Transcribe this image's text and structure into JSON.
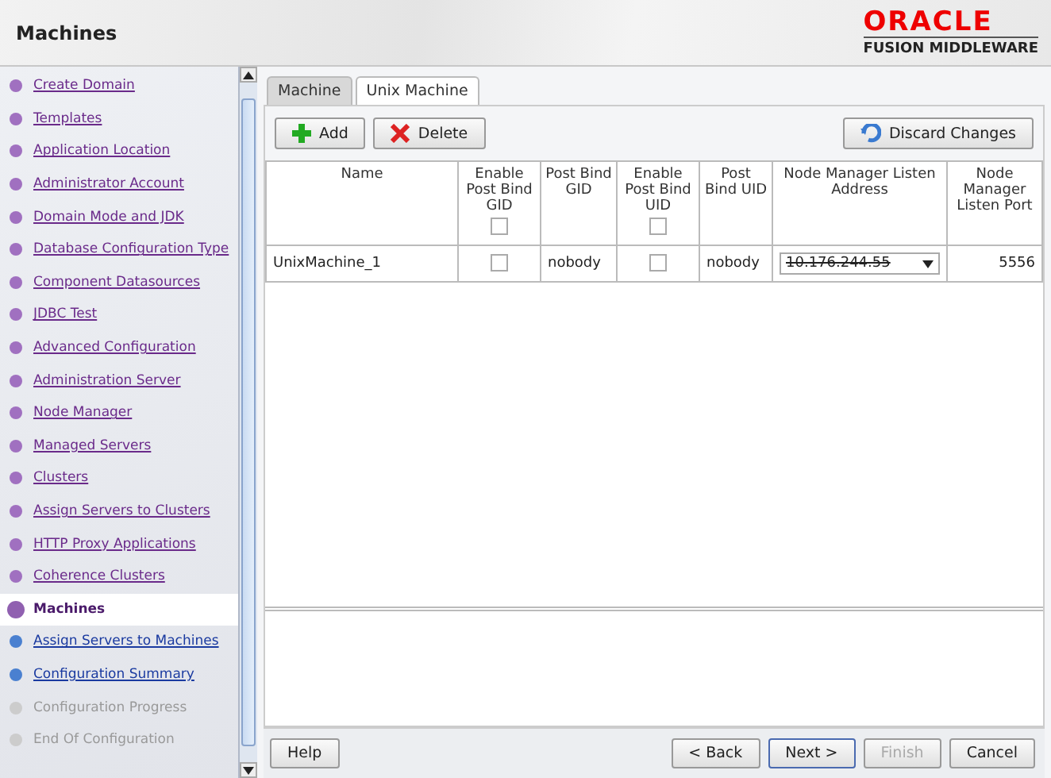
{
  "header": {
    "title": "Machines",
    "logo_top": "ORACLE",
    "logo_bottom": "FUSION MIDDLEWARE"
  },
  "steps": [
    {
      "label": "Create Domain",
      "kind": "visited"
    },
    {
      "label": "Templates",
      "kind": "visited"
    },
    {
      "label": "Application Location",
      "kind": "visited"
    },
    {
      "label": "Administrator Account",
      "kind": "visited"
    },
    {
      "label": "Domain Mode and JDK",
      "kind": "visited"
    },
    {
      "label": "Database Configuration Type",
      "kind": "visited"
    },
    {
      "label": "Component Datasources",
      "kind": "visited"
    },
    {
      "label": "JDBC Test",
      "kind": "visited"
    },
    {
      "label": "Advanced Configuration",
      "kind": "visited"
    },
    {
      "label": "Administration Server",
      "kind": "visited"
    },
    {
      "label": "Node Manager",
      "kind": "visited"
    },
    {
      "label": "Managed Servers",
      "kind": "visited"
    },
    {
      "label": "Clusters",
      "kind": "visited"
    },
    {
      "label": "Assign Servers to Clusters",
      "kind": "visited"
    },
    {
      "label": "HTTP Proxy Applications",
      "kind": "visited"
    },
    {
      "label": "Coherence Clusters",
      "kind": "visited"
    },
    {
      "label": "Machines",
      "kind": "current"
    },
    {
      "label": "Assign Servers to Machines",
      "kind": "pending"
    },
    {
      "label": "Configuration Summary",
      "kind": "pending"
    },
    {
      "label": "Configuration Progress",
      "kind": "disabled"
    },
    {
      "label": "End Of Configuration",
      "kind": "disabled"
    }
  ],
  "tabs": [
    {
      "label": "Machine",
      "selected": false
    },
    {
      "label": "Unix Machine",
      "selected": true
    }
  ],
  "toolbar": {
    "add": "Add",
    "delete": "Delete",
    "discard": "Discard Changes"
  },
  "table": {
    "columns": [
      {
        "label": "Name"
      },
      {
        "label": "Enable Post Bind GID",
        "checked": false
      },
      {
        "label": "Post Bind GID"
      },
      {
        "label": "Enable Post Bind UID",
        "checked": false
      },
      {
        "label": "Post Bind UID"
      },
      {
        "label": "Node Manager Listen Address"
      },
      {
        "label": "Node Manager Listen Port"
      }
    ],
    "rows": [
      {
        "name": "UnixMachine_1",
        "enable_gid": false,
        "gid": "nobody",
        "enable_uid": false,
        "uid": "nobody",
        "address": "10.176.244.55",
        "port": "5556"
      }
    ]
  },
  "footer": {
    "help": "Help",
    "back": "< Back",
    "next": "Next >",
    "finish": "Finish",
    "finish_disabled": true,
    "cancel": "Cancel"
  }
}
